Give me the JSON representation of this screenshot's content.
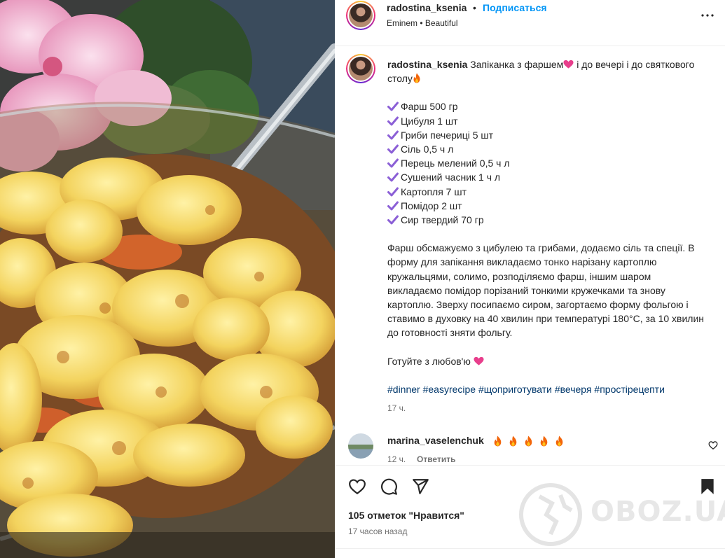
{
  "post": {
    "username": "radostina_ksenia",
    "separator": "•",
    "follow_label": "Подписаться",
    "audio": "Eminem • Beautiful"
  },
  "caption": {
    "username": "radostina_ksenia",
    "title_a": "Запіканка з фаршем",
    "title_b": " і до вечері і до святкового столу",
    "ingredients": [
      "Фарш 500 гр",
      "Цибуля 1 шт",
      "Гриби печериці 5 шт",
      "Сіль 0,5 ч л",
      "Перець мелений 0,5 ч л",
      "Сушений часник 1 ч л",
      "Картопля 7 шт",
      "Помідор 2 шт",
      "Сир твердий 70 гр"
    ],
    "method": "Фарш обсмажуємо з цибулею та грибами, додаємо сіль та спеції. В форму для запікання викладаємо тонко нарізану картоплю кружальцями, солимо, розподіляємо фарш, іншим шаром викладаємо помідор порізаний тонкими кружечками та знову картоплю. Зверху посипаємо сиром, загортаємо форму фольгою і ставимо в духовку на 40 хвилин при температурі 180°C, за 10 хвилин до готовності зняти фольгу.",
    "closing": "Готуйте з любов'ю",
    "hashtags": [
      "#dinner",
      "#easyrecipe",
      "#щоприготувати",
      "#вечеря",
      "#простірецепти"
    ],
    "time": "17 ч."
  },
  "comment": {
    "username": "marina_vaselenchuk",
    "time": "12 ч.",
    "reply_label": "Ответить"
  },
  "footer": {
    "likes": "105 отметок \"Нравится\"",
    "posted_ago": "17 часов назад"
  },
  "watermark": {
    "text": "OBOZ.UA"
  },
  "colors": {
    "link": "#0095f6",
    "hashtag": "#00376b",
    "secondary_text": "#737373",
    "check": "#8b5fd6",
    "heart": "#e83e8c",
    "fire": "#f2650a"
  },
  "icons": [
    "more-options-icon",
    "check-icon",
    "heart-emoji-icon",
    "fire-emoji-icon",
    "like-icon",
    "comment-icon",
    "share-icon",
    "bookmark-icon",
    "comment-like-icon",
    "globe-watermark-icon"
  ]
}
